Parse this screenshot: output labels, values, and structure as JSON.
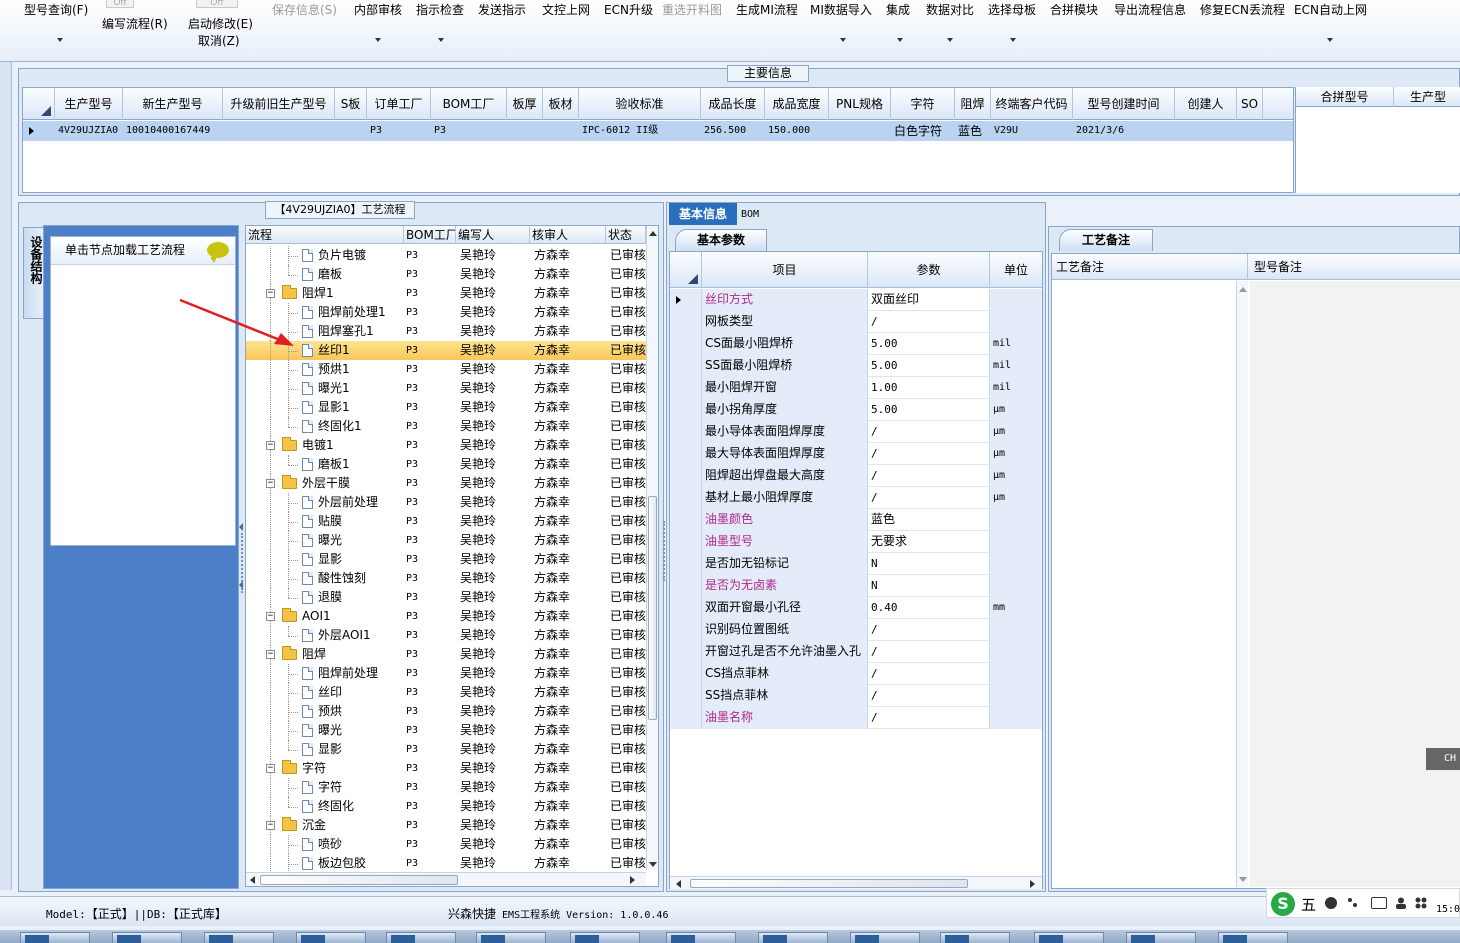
{
  "toolbar": {
    "items": [
      {
        "label": "型号查询(F)",
        "enabled": true
      },
      {
        "label": "编写流程(R)",
        "enabled": true
      },
      {
        "label": "启动修改(E)",
        "enabled": true
      },
      {
        "label": "取消(Z)",
        "enabled": true
      },
      {
        "label": "保存信息(S)",
        "enabled": false
      },
      {
        "label": "内部审核",
        "enabled": true
      },
      {
        "label": "指示检查",
        "enabled": true
      },
      {
        "label": "发送指示",
        "enabled": true
      },
      {
        "label": "文控上网",
        "enabled": true
      },
      {
        "label": "ECN升级",
        "enabled": true
      },
      {
        "label": "重选开料图",
        "enabled": false
      },
      {
        "label": "生成MI流程",
        "enabled": true
      },
      {
        "label": "MI数据导入",
        "enabled": true
      },
      {
        "label": "集成",
        "enabled": true
      },
      {
        "label": "数据对比",
        "enabled": true
      },
      {
        "label": "选择母板",
        "enabled": true
      },
      {
        "label": "合拼模块",
        "enabled": true
      },
      {
        "label": "导出流程信息",
        "enabled": true
      },
      {
        "label": "修复ECN丢流程",
        "enabled": true
      },
      {
        "label": "ECN自动上网",
        "enabled": true
      }
    ],
    "toggle_stub": "Off"
  },
  "main_info": {
    "title": "主要信息",
    "columns": [
      "生产型号",
      "新生产型号",
      "升级前旧生产型号",
      "S板",
      "订单工厂",
      "BOM工厂",
      "板厚",
      "板材",
      "验收标准",
      "成品长度",
      "成品宽度",
      "PNL规格",
      "字符",
      "阻焊",
      "终端客户代码",
      "型号创建时间",
      "创建人",
      "SO"
    ],
    "row": [
      "4V29UJZIA0",
      "10010400167449",
      "",
      "",
      "P3",
      "P3",
      "",
      "",
      "IPC-6012 II级",
      "256.500",
      "150.000",
      "",
      "白色字符",
      "蓝色",
      "V29U",
      "2021/3/6",
      "",
      ""
    ],
    "right_columns": [
      "合拼型号",
      "生产型"
    ]
  },
  "process": {
    "title": "【4V29UJZIA0】工艺流程",
    "side_tab": "设备结构",
    "node_hint": "单击节点加载工艺流程",
    "columns": [
      "流程",
      "BOM工厂",
      "编写人",
      "核审人",
      "状态"
    ],
    "rows": [
      {
        "name": "负片电镀",
        "level": 2,
        "type": "leaf",
        "bom": "P3",
        "writer": "吴艳玲",
        "reviewer": "方森幸",
        "status": "已审核"
      },
      {
        "name": "磨板",
        "level": 2,
        "type": "leaf",
        "last": true,
        "bom": "P3",
        "writer": "吴艳玲",
        "reviewer": "方森幸",
        "status": "已审核"
      },
      {
        "name": "阻焊1",
        "level": 1,
        "type": "folder",
        "bom": "P3",
        "writer": "吴艳玲",
        "reviewer": "方森幸",
        "status": "已审核"
      },
      {
        "name": "阻焊前处理1",
        "level": 2,
        "type": "leaf",
        "bom": "P3",
        "writer": "吴艳玲",
        "reviewer": "方森幸",
        "status": "已审核"
      },
      {
        "name": "阻焊塞孔1",
        "level": 2,
        "type": "leaf",
        "bom": "P3",
        "writer": "吴艳玲",
        "reviewer": "方森幸",
        "status": "已审核"
      },
      {
        "name": "丝印1",
        "level": 2,
        "type": "leaf",
        "selected": true,
        "bom": "P3",
        "writer": "吴艳玲",
        "reviewer": "方森幸",
        "status": "已审核"
      },
      {
        "name": "预烘1",
        "level": 2,
        "type": "leaf",
        "bom": "P3",
        "writer": "吴艳玲",
        "reviewer": "方森幸",
        "status": "已审核"
      },
      {
        "name": "曝光1",
        "level": 2,
        "type": "leaf",
        "bom": "P3",
        "writer": "吴艳玲",
        "reviewer": "方森幸",
        "status": "已审核"
      },
      {
        "name": "显影1",
        "level": 2,
        "type": "leaf",
        "bom": "P3",
        "writer": "吴艳玲",
        "reviewer": "方森幸",
        "status": "已审核"
      },
      {
        "name": "终固化1",
        "level": 2,
        "type": "leaf",
        "last": true,
        "bom": "P3",
        "writer": "吴艳玲",
        "reviewer": "方森幸",
        "status": "已审核"
      },
      {
        "name": "电镀1",
        "level": 1,
        "type": "folder",
        "bom": "P3",
        "writer": "吴艳玲",
        "reviewer": "方森幸",
        "status": "已审核"
      },
      {
        "name": "磨板1",
        "level": 2,
        "type": "leaf",
        "last": true,
        "bom": "P3",
        "writer": "吴艳玲",
        "reviewer": "方森幸",
        "status": "已审核"
      },
      {
        "name": "外层干膜",
        "level": 1,
        "type": "folder",
        "bom": "P3",
        "writer": "吴艳玲",
        "reviewer": "方森幸",
        "status": "已审核"
      },
      {
        "name": "外层前处理",
        "level": 2,
        "type": "leaf",
        "bom": "P3",
        "writer": "吴艳玲",
        "reviewer": "方森幸",
        "status": "已审核"
      },
      {
        "name": "贴膜",
        "level": 2,
        "type": "leaf",
        "bom": "P3",
        "writer": "吴艳玲",
        "reviewer": "方森幸",
        "status": "已审核"
      },
      {
        "name": "曝光",
        "level": 2,
        "type": "leaf",
        "bom": "P3",
        "writer": "吴艳玲",
        "reviewer": "方森幸",
        "status": "已审核"
      },
      {
        "name": "显影",
        "level": 2,
        "type": "leaf",
        "bom": "P3",
        "writer": "吴艳玲",
        "reviewer": "方森幸",
        "status": "已审核"
      },
      {
        "name": "酸性蚀刻",
        "level": 2,
        "type": "leaf",
        "bom": "P3",
        "writer": "吴艳玲",
        "reviewer": "方森幸",
        "status": "已审核"
      },
      {
        "name": "退膜",
        "level": 2,
        "type": "leaf",
        "last": true,
        "bom": "P3",
        "writer": "吴艳玲",
        "reviewer": "方森幸",
        "status": "已审核"
      },
      {
        "name": "AOI1",
        "level": 1,
        "type": "folder",
        "bom": "P3",
        "writer": "吴艳玲",
        "reviewer": "方森幸",
        "status": "已审核"
      },
      {
        "name": "外层AOI1",
        "level": 2,
        "type": "leaf",
        "last": true,
        "bom": "P3",
        "writer": "吴艳玲",
        "reviewer": "方森幸",
        "status": "已审核"
      },
      {
        "name": "阻焊",
        "level": 1,
        "type": "folder",
        "bom": "P3",
        "writer": "吴艳玲",
        "reviewer": "方森幸",
        "status": "已审核"
      },
      {
        "name": "阻焊前处理",
        "level": 2,
        "type": "leaf",
        "bom": "P3",
        "writer": "吴艳玲",
        "reviewer": "方森幸",
        "status": "已审核"
      },
      {
        "name": "丝印",
        "level": 2,
        "type": "leaf",
        "bom": "P3",
        "writer": "吴艳玲",
        "reviewer": "方森幸",
        "status": "已审核"
      },
      {
        "name": "预烘",
        "level": 2,
        "type": "leaf",
        "bom": "P3",
        "writer": "吴艳玲",
        "reviewer": "方森幸",
        "status": "已审核"
      },
      {
        "name": "曝光",
        "level": 2,
        "type": "leaf",
        "bom": "P3",
        "writer": "吴艳玲",
        "reviewer": "方森幸",
        "status": "已审核"
      },
      {
        "name": "显影",
        "level": 2,
        "type": "leaf",
        "last": true,
        "bom": "P3",
        "writer": "吴艳玲",
        "reviewer": "方森幸",
        "status": "已审核"
      },
      {
        "name": "字符",
        "level": 1,
        "type": "folder",
        "bom": "P3",
        "writer": "吴艳玲",
        "reviewer": "方森幸",
        "status": "已审核"
      },
      {
        "name": "字符",
        "level": 2,
        "type": "leaf",
        "bom": "P3",
        "writer": "吴艳玲",
        "reviewer": "方森幸",
        "status": "已审核"
      },
      {
        "name": "终固化",
        "level": 2,
        "type": "leaf",
        "last": true,
        "bom": "P3",
        "writer": "吴艳玲",
        "reviewer": "方森幸",
        "status": "已审核"
      },
      {
        "name": "沉金",
        "level": 1,
        "type": "folder",
        "bom": "P3",
        "writer": "吴艳玲",
        "reviewer": "方森幸",
        "status": "已审核"
      },
      {
        "name": "喷砂",
        "level": 2,
        "type": "leaf",
        "bom": "P3",
        "writer": "吴艳玲",
        "reviewer": "方森幸",
        "status": "已审核"
      },
      {
        "name": "板边包胶",
        "level": 2,
        "type": "leaf",
        "bom": "P3",
        "writer": "吴艳玲",
        "reviewer": "方森幸",
        "status": "已审核"
      }
    ]
  },
  "params": {
    "tabs": [
      "基本信息",
      "BOM"
    ],
    "subtab": "基本参数",
    "columns": [
      "项目",
      "参数",
      "单位"
    ],
    "rows": [
      {
        "item": "丝印方式",
        "value": "双面丝印",
        "unit": "",
        "highlight": true,
        "current": true
      },
      {
        "item": "网板类型",
        "value": "/",
        "unit": ""
      },
      {
        "item": "CS面最小阻焊桥",
        "value": "5.00",
        "unit": "mil"
      },
      {
        "item": "SS面最小阻焊桥",
        "value": "5.00",
        "unit": "mil"
      },
      {
        "item": "最小阻焊开窗",
        "value": "1.00",
        "unit": "mil"
      },
      {
        "item": "最小拐角厚度",
        "value": "5.00",
        "unit": "μm"
      },
      {
        "item": "最小导体表面阻焊厚度",
        "value": "/",
        "unit": "μm"
      },
      {
        "item": "最大导体表面阻焊厚度",
        "value": "/",
        "unit": "μm"
      },
      {
        "item": "阻焊超出焊盘最大高度",
        "value": "/",
        "unit": "μm"
      },
      {
        "item": "基材上最小阻焊厚度",
        "value": "/",
        "unit": "μm"
      },
      {
        "item": "油墨颜色",
        "value": "蓝色",
        "unit": "",
        "highlight": true
      },
      {
        "item": "油墨型号",
        "value": "无要求",
        "unit": "",
        "highlight": true
      },
      {
        "item": "是否加无铅标记",
        "value": "N",
        "unit": ""
      },
      {
        "item": "是否为无卤素",
        "value": "N",
        "unit": "",
        "highlight": true
      },
      {
        "item": "双面开窗最小孔径",
        "value": "0.40",
        "unit": "mm"
      },
      {
        "item": "识别码位置图纸",
        "value": "/",
        "unit": ""
      },
      {
        "item": "开窗过孔是否不允许油墨入孔",
        "value": "/",
        "unit": ""
      },
      {
        "item": "CS挡点菲林",
        "value": "/",
        "unit": ""
      },
      {
        "item": "SS挡点菲林",
        "value": "/",
        "unit": ""
      },
      {
        "item": "油墨名称",
        "value": "/",
        "unit": "",
        "highlight": true
      }
    ]
  },
  "remarks": {
    "subtab": "工艺备注",
    "columns": [
      "工艺备注",
      "型号备注"
    ]
  },
  "status_bar": {
    "model_label": "Model:",
    "model_value": "【正式】",
    "sep": "||",
    "db_label": "DB:",
    "db_value": "【正式库】",
    "company": "兴森快捷",
    "system": " EMS工程系统 Version: 1.0.0.46",
    "clock": "15:0"
  },
  "ime": {
    "logo": "S",
    "mode": "五"
  },
  "chat_pill": "CH",
  "colors": {
    "accent": "#2a6fbd",
    "selection": "#b9d3f1",
    "tree_selected": "#f7c75a",
    "pink_label": "#b0288a"
  }
}
